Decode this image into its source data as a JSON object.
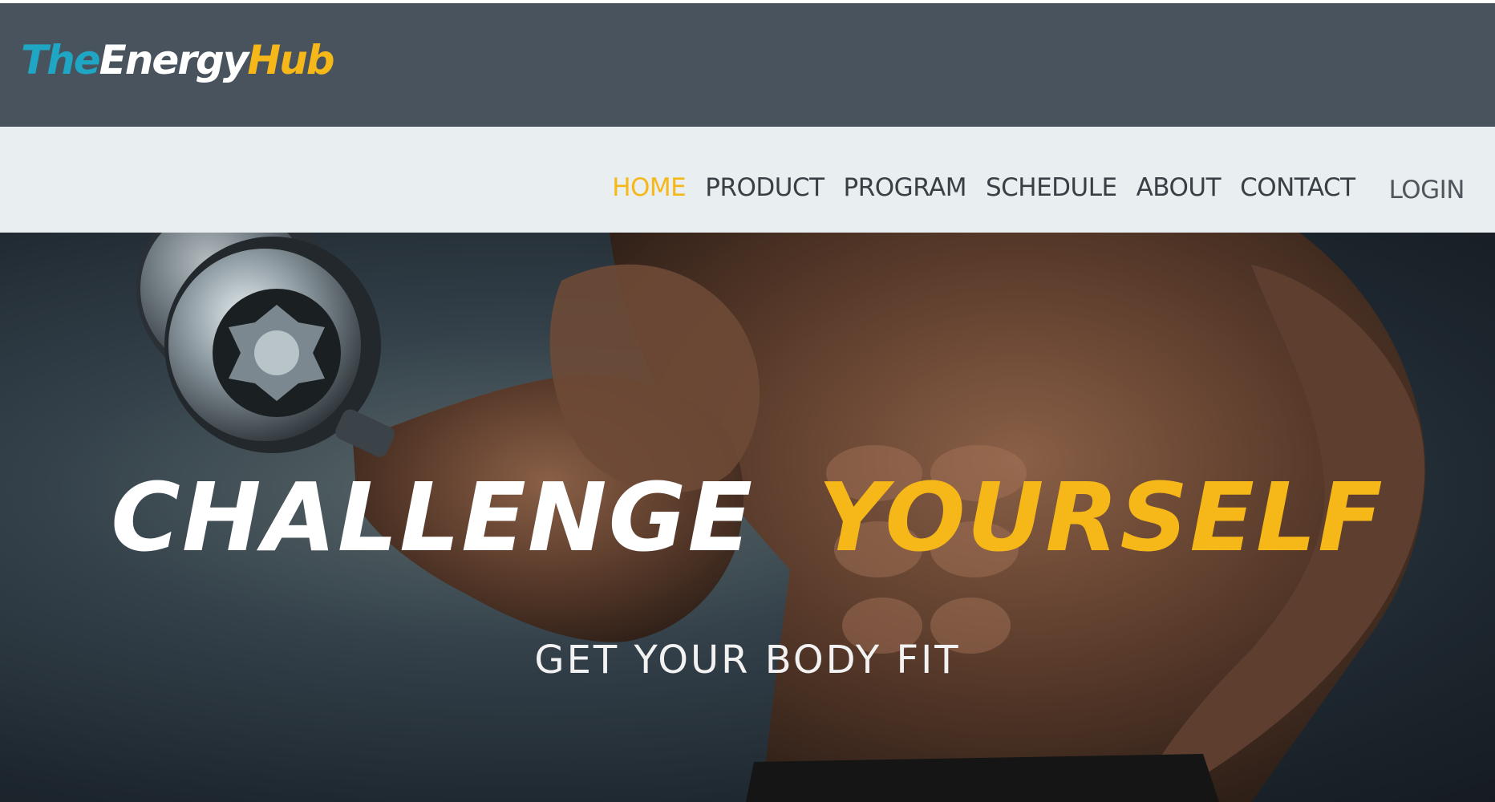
{
  "colors": {
    "accent": "#f6b719",
    "logo_the": "#1ea6c4",
    "logo_energy": "#ffffff",
    "logo_hub": "#f6b719",
    "header_dark": "#48535e",
    "nav_light": "#e9eef1"
  },
  "brand": {
    "logo_part1": "The",
    "logo_part2": "Energy",
    "logo_part3": "Hub"
  },
  "nav": {
    "items": [
      {
        "label": "HOME",
        "active": true
      },
      {
        "label": "PRODUCT",
        "active": false
      },
      {
        "label": "PROGRAM",
        "active": false
      },
      {
        "label": "SCHEDULE",
        "active": false
      },
      {
        "label": "ABOUT",
        "active": false
      },
      {
        "label": "CONTACT",
        "active": false
      }
    ],
    "login_label": "LOGIN"
  },
  "hero": {
    "headline_word1": "CHALLENGE",
    "headline_word2": "YOURSELF",
    "subheadline": "GET YOUR BODY FIT"
  }
}
